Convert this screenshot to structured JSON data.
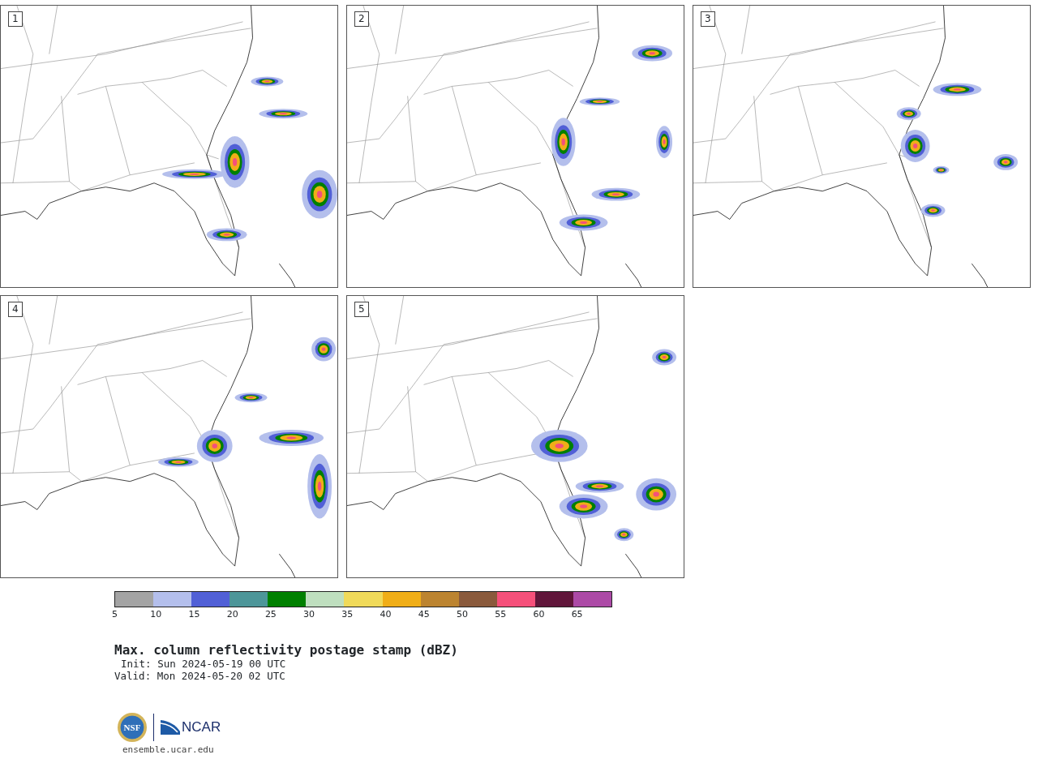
{
  "panels": [
    {
      "label": "1"
    },
    {
      "label": "2"
    },
    {
      "label": "3"
    },
    {
      "label": "4"
    },
    {
      "label": "5"
    }
  ],
  "colorbar": {
    "bins": [
      {
        "color": "#a4a4a4"
      },
      {
        "color": "#b4bfec"
      },
      {
        "color": "#5160d6"
      },
      {
        "color": "#4d9699"
      },
      {
        "color": "#008000"
      },
      {
        "color": "#bfdfbf"
      },
      {
        "color": "#f0da5a"
      },
      {
        "color": "#f0ae18"
      },
      {
        "color": "#bc8430"
      },
      {
        "color": "#8a5a3c"
      },
      {
        "color": "#f5507a"
      },
      {
        "color": "#60163a"
      },
      {
        "color": "#ac4aa6"
      }
    ],
    "ticks": [
      "5",
      "10",
      "15",
      "20",
      "25",
      "30",
      "35",
      "40",
      "45",
      "50",
      "55",
      "60",
      "65"
    ]
  },
  "title": "Max. column reflectivity postage stamp (dBZ)",
  "init": "Init: Sun 2024-05-19 00 UTC",
  "valid": "Valid: Mon 2024-05-20 02 UTC",
  "logo": {
    "seal": "NSF",
    "wordmark": "NCAR"
  },
  "url": "ensemble.ucar.edu"
}
